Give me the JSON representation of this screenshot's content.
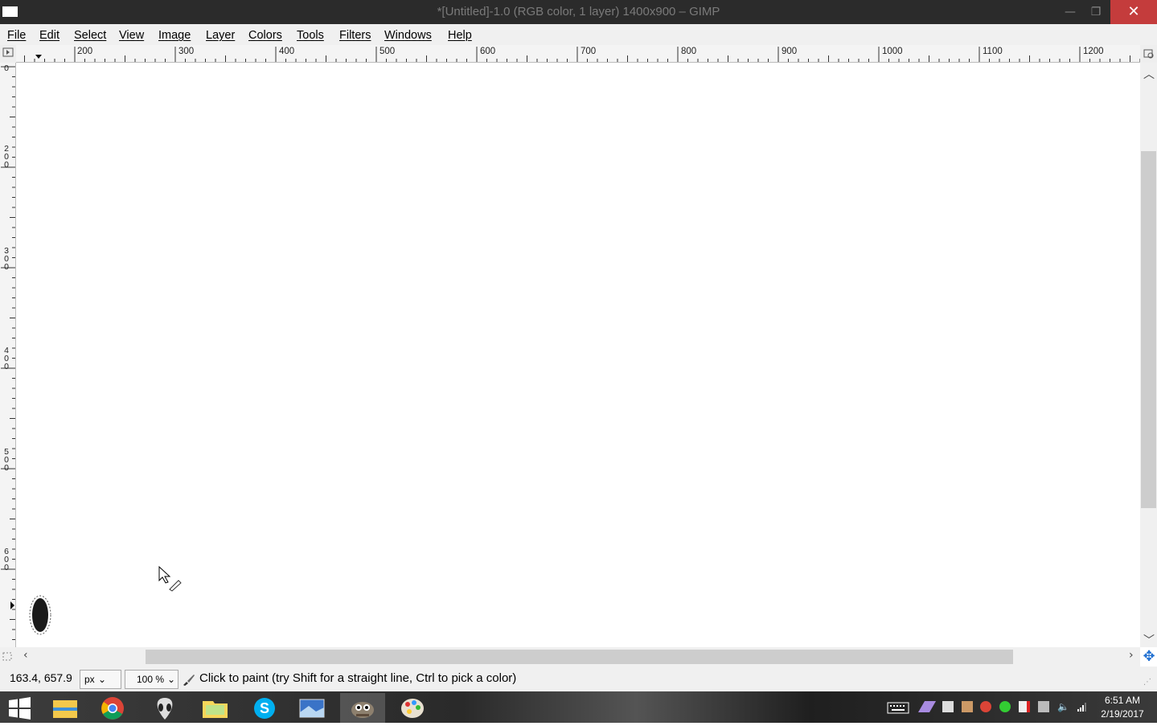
{
  "window": {
    "title": "*[Untitled]-1.0 (RGB color, 1 layer) 1400x900 – GIMP",
    "minimize": "—",
    "maximize": "❐",
    "close": "✕"
  },
  "menubar": {
    "items": [
      "File",
      "Edit",
      "Select",
      "View",
      "Image",
      "Layer",
      "Colors",
      "Tools",
      "Filters",
      "Windows",
      "Help"
    ]
  },
  "rulers": {
    "horizontal": [
      "200",
      "300",
      "400",
      "500",
      "600",
      "700",
      "800",
      "900",
      "1000",
      "1100",
      "1200"
    ],
    "vertical": [
      "0",
      "200",
      "300",
      "400",
      "500",
      "600"
    ]
  },
  "statusbar": {
    "coords": "163.4, 657.9",
    "unit": "px",
    "zoom": "100 %",
    "message": "Click to paint (try Shift for a straight line, Ctrl to pick a color)"
  },
  "taskbar": {
    "apps": [
      "start-icon",
      "file-explorer-icon",
      "chrome-icon",
      "alienware-icon",
      "folder-icon",
      "skype-icon",
      "window-icon",
      "gimp-icon",
      "paint-icon"
    ],
    "time": "6:51 AM",
    "date": "2/19/2017"
  },
  "colors": {
    "titlebar": "#2b2b2b",
    "close": "#c43c3c",
    "menubar": "#f0f0f0",
    "canvas": "#ffffff"
  }
}
